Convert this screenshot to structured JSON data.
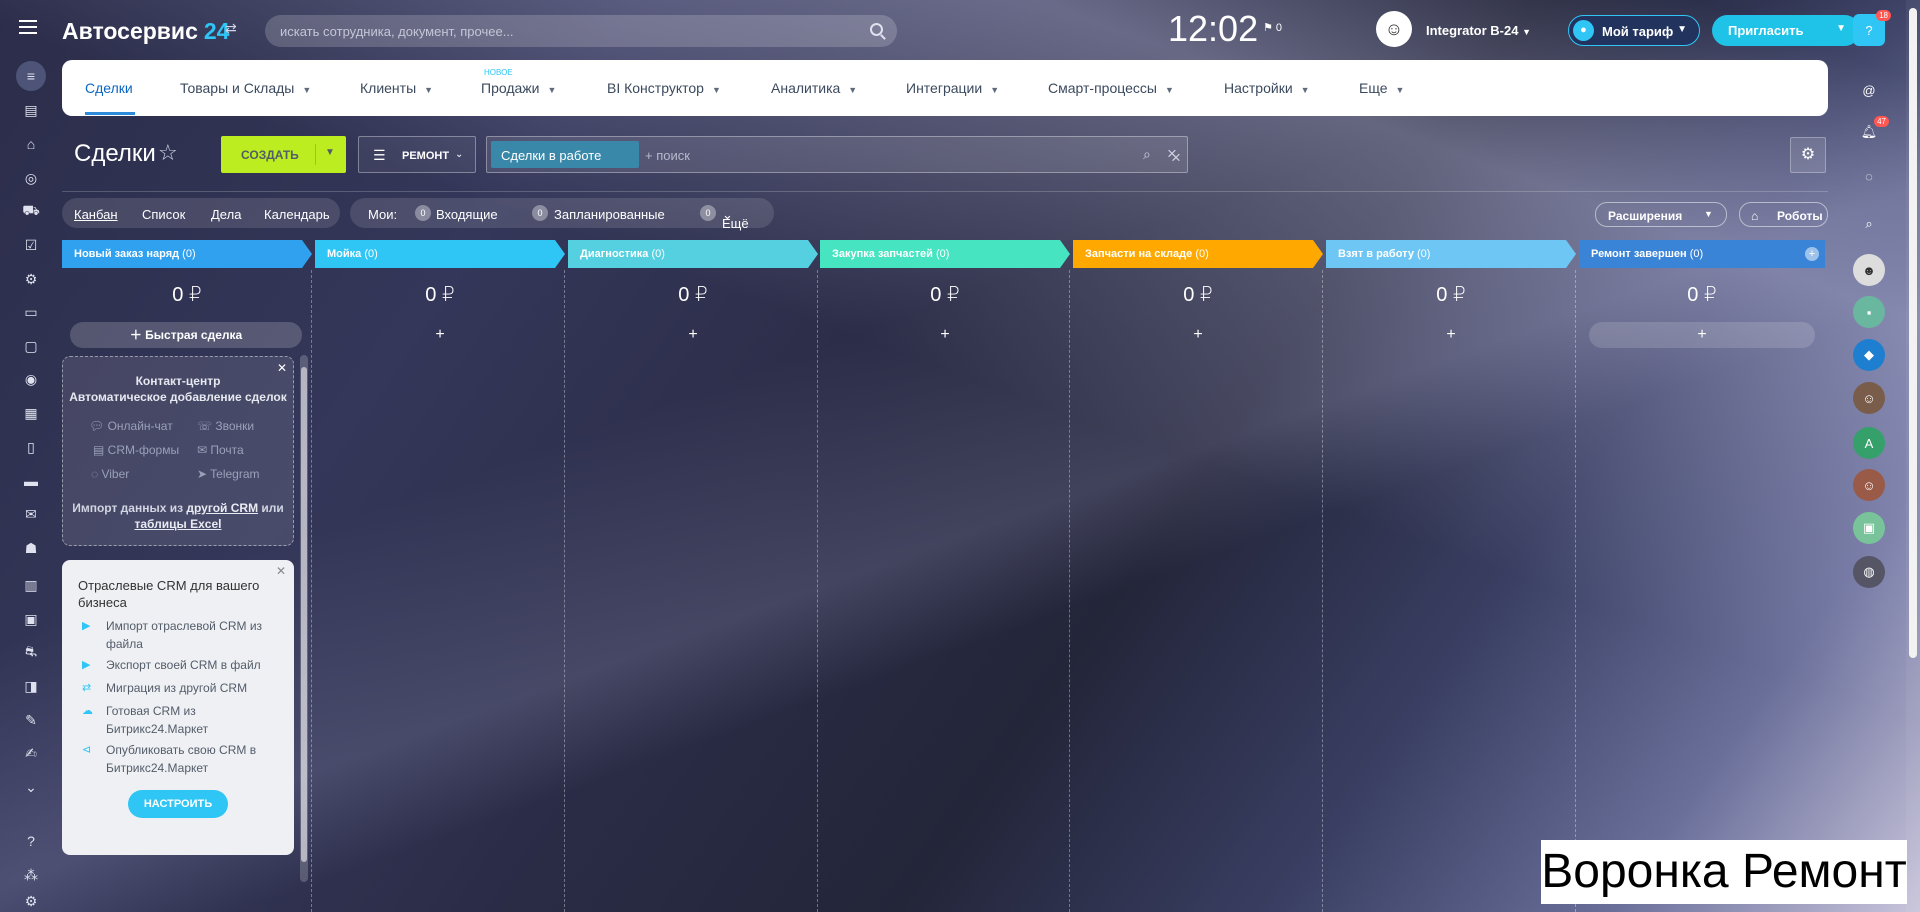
{
  "app": {
    "name": "Автосервис",
    "number": "24"
  },
  "search": {
    "placeholder": "искать сотрудника, документ, прочее..."
  },
  "clock": "12:02",
  "flag_count": "0",
  "user": {
    "name": "Integrator B-24"
  },
  "tariff": "Мой тариф",
  "invite": "Пригласить",
  "help_badge": "18",
  "notif_badge": "47",
  "nav": {
    "tabs": [
      "Сделки",
      "Товары и Склады",
      "Клиенты",
      "Продажи",
      "BI Конструктор",
      "Аналитика",
      "Интеграции",
      "Смарт-процессы",
      "Настройки",
      "Еще"
    ],
    "new_badge": "НОВОЕ"
  },
  "page": {
    "title": "Сделки",
    "create": "СОЗДАТЬ",
    "preset": "РЕМОНТ",
    "filter_chip": "Сделки в работе",
    "filter_placeholder": "+ поиск"
  },
  "views": [
    "Канбан",
    "Список",
    "Дела",
    "Календарь"
  ],
  "mine": {
    "label": "Мои:",
    "incoming": "Входящие",
    "planned": "Запланированные",
    "more": "Ещё",
    "counts": [
      "0",
      "0",
      "0"
    ]
  },
  "extensions": "Расширения",
  "robots": "Роботы",
  "columns": [
    {
      "title": "Новый заказ наряд",
      "count": "(0)",
      "sum": "0 ₽",
      "color": "#2fa1ef"
    },
    {
      "title": "Мойка",
      "count": "(0)",
      "sum": "0 ₽",
      "color": "#2fc6f6"
    },
    {
      "title": "Диагностика",
      "count": "(0)",
      "sum": "0 ₽",
      "color": "#55d0e0"
    },
    {
      "title": "Закупка запчастей",
      "count": "(0)",
      "sum": "0 ₽",
      "color": "#47e4c2"
    },
    {
      "title": "Запчасти на складе",
      "count": "(0)",
      "sum": "0 ₽",
      "color": "#ffa900"
    },
    {
      "title": "Взят в работу",
      "count": "(0)",
      "sum": "0 ₽",
      "color": "#6ec6f5"
    },
    {
      "title": "Ремонт завершен",
      "count": "(0)",
      "sum": "0 ₽",
      "color": "#3a84d8"
    }
  ],
  "quick_deal": "Быстрая сделка",
  "contact_center": {
    "title1": "Контакт-центр",
    "title2": "Автоматическое добавление сделок",
    "channels": [
      "Онлайн-чат",
      "Звонки",
      "CRM-формы",
      "Почта",
      "Viber",
      "Telegram"
    ],
    "import_text1": "Импорт данных из ",
    "import_link1": "другой CRM",
    "import_text2": " или",
    "import_link2": "таблицы Excel"
  },
  "industry": {
    "title": "Отраслевые CRM для вашего бизнеса",
    "items": [
      "Импорт отраслевой CRM из файла",
      "Экспорт своей CRM в файл",
      "Миграция из другой CRM",
      "Готовая CRM из Битрикс24.Маркет",
      "Опубликовать свою CRM в Битрикс24.Маркет"
    ],
    "button": "НАСТРОИТЬ"
  },
  "watermark": "Воронка Ремонт"
}
